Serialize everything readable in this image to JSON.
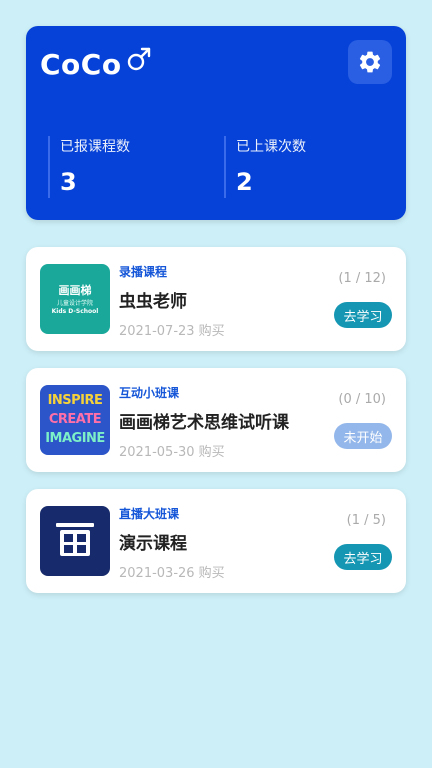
{
  "profile": {
    "name": "CoCo",
    "gender_icon": "male-icon",
    "settings_icon": "gear-icon",
    "stats": [
      {
        "label": "已报课程数",
        "value": "3"
      },
      {
        "label": "已上课次数",
        "value": "2"
      }
    ]
  },
  "courses": [
    {
      "type": "录播课程",
      "title": "虫虫老师",
      "date": "2021-07-23 购买",
      "progress": "(1 / 12)",
      "action": "去学习",
      "thumb": {
        "line1": "画画梯",
        "line2": "儿童设计学院",
        "line3": "Kids D-School"
      }
    },
    {
      "type": "互动小班课",
      "title": "画画梯艺术思维试听课",
      "date": "2021-05-30 购买",
      "progress": "(0 / 10)",
      "action": "未开始",
      "thumb": {
        "line1": "INSPIRE",
        "line2": "CREATE",
        "line3": "IMAGINE"
      }
    },
    {
      "type": "直播大班课",
      "title": "演示课程",
      "date": "2021-03-26 购买",
      "progress": "(1 / 5)",
      "action": "去学习"
    }
  ],
  "colors": {
    "background": "#cdeff7",
    "profile_card": "#0642d8",
    "course_type": "#1556d8",
    "action_active": "#1597b3",
    "action_disabled": "#93b7ea"
  }
}
